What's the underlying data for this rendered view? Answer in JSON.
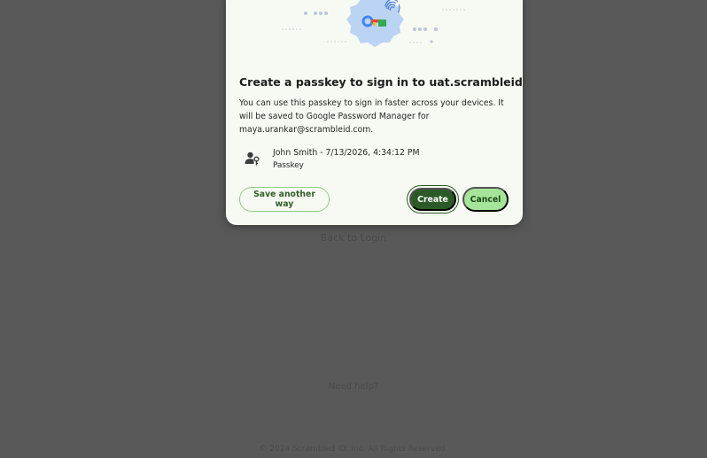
{
  "background": {
    "back_to_login": "Back to Login",
    "need_help": "Need help?",
    "footer": "© 2024 Scrambled ID, Inc. All Rights Reserved."
  },
  "dialog": {
    "title": "Create a passkey to sign in to uat.scrambleid.com?",
    "description": "You can use this passkey to sign in faster across your devices. It will be saved to Google Password Manager for maya.urankar@scrambleid.com.",
    "credential": {
      "name_line": "John Smith - 7/13/2026, 4:34:12 PM",
      "type": "Passkey"
    },
    "buttons": {
      "save_another_way": "Save another way",
      "create": "Create",
      "cancel": "Cancel"
    }
  },
  "colors": {
    "overlay": "#595959",
    "dialog_bg": "#f7faf2",
    "primary": "#2c5a27",
    "secondary": "#a6e49a"
  },
  "icons": {
    "hero": "passkey-key-icon",
    "fingerprint": "fingerprint-icon",
    "credential": "person-key-icon"
  }
}
